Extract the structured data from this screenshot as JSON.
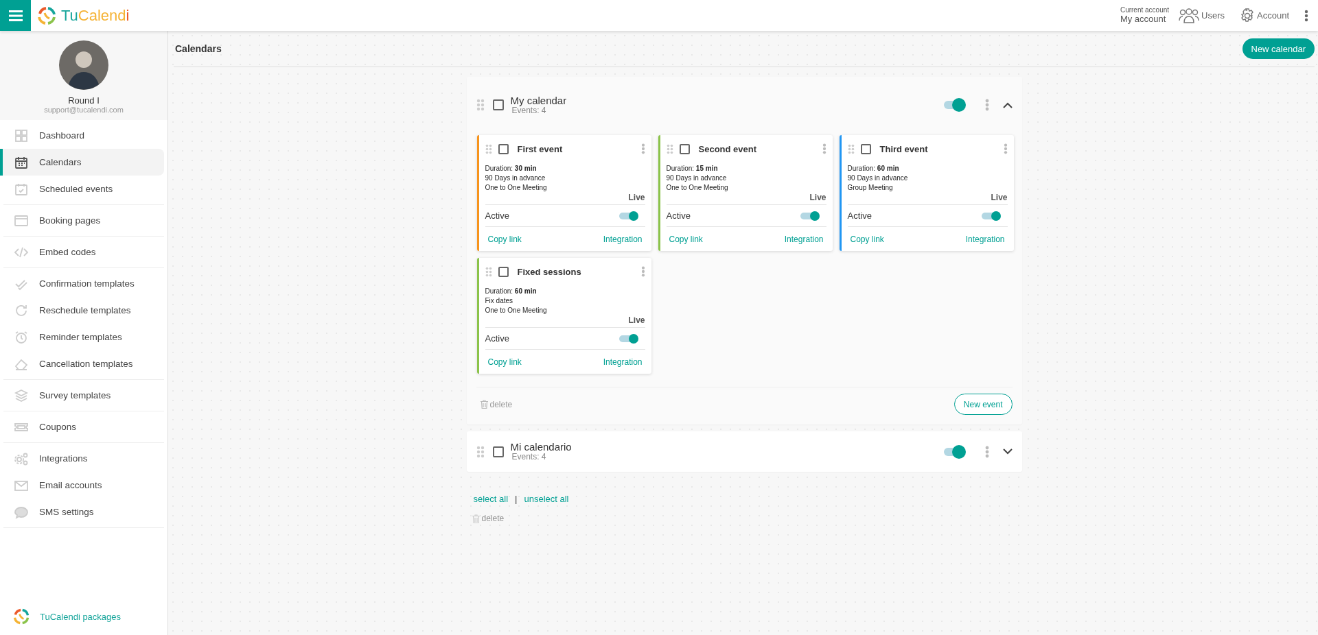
{
  "topbar": {
    "logo": [
      {
        "text": "Tu",
        "color": "#16a59b"
      },
      {
        "text": "Calend",
        "color": "#f5b335"
      },
      {
        "text": "i",
        "color": "#ec5a2a"
      }
    ],
    "current_account_label": "Current account",
    "current_account": "My account",
    "users": "Users",
    "account": "Account"
  },
  "sidebar": {
    "profile": {
      "name": "Round I",
      "email": "support@tucalendi.com"
    },
    "groups": [
      {
        "items": [
          {
            "label": "Dashboard",
            "selected": false
          },
          {
            "label": "Calendars",
            "selected": true
          },
          {
            "label": "Scheduled events",
            "selected": false
          }
        ]
      },
      {
        "items": [
          {
            "label": "Booking pages",
            "selected": false
          }
        ]
      },
      {
        "items": [
          {
            "label": "Embed codes",
            "selected": false
          }
        ]
      },
      {
        "items": [
          {
            "label": "Confirmation templates",
            "selected": false
          },
          {
            "label": "Reschedule templates",
            "selected": false
          },
          {
            "label": "Reminder templates",
            "selected": false
          },
          {
            "label": "Cancellation templates",
            "selected": false
          }
        ]
      },
      {
        "items": [
          {
            "label": "Survey templates",
            "selected": false
          }
        ]
      },
      {
        "items": [
          {
            "label": "Coupons",
            "selected": false
          }
        ]
      },
      {
        "items": [
          {
            "label": "Integrations",
            "selected": false
          },
          {
            "label": "Email accounts",
            "selected": false
          },
          {
            "label": "SMS settings",
            "selected": false
          }
        ]
      }
    ],
    "footer": "TuCalendi packages"
  },
  "page": {
    "title": "Calendars",
    "new_calendar": "New calendar"
  },
  "calendars": [
    {
      "name": "My calendar",
      "events_count": "Events: 4",
      "checked": false,
      "on": true,
      "expanded": true,
      "delete": "delete",
      "new_event": "New event",
      "events": [
        {
          "title": "First event",
          "checked": false,
          "color": "#f7941d",
          "details": [
            "Duration: **30 min**",
            "90 Days in advance",
            "One to One Meeting"
          ],
          "status": "Live",
          "active_label": "Active",
          "active": true,
          "copy_link": "Copy link",
          "integration": "Integration"
        },
        {
          "title": "Second event",
          "checked": false,
          "color": "#8bc34a",
          "details": [
            "Duration: **15 min**",
            "90 Days in advance",
            "One to One Meeting"
          ],
          "status": "Live",
          "active_label": "Active",
          "active": true,
          "copy_link": "Copy link",
          "integration": "Integration"
        },
        {
          "title": "Third event",
          "checked": false,
          "color": "#2196f3",
          "details": [
            "Duration: **60 min**",
            "90 Days in advance",
            "Group Meeting"
          ],
          "status": "Live",
          "active_label": "Active",
          "active": true,
          "copy_link": "Copy link",
          "integration": "Integration"
        },
        {
          "title": "Fixed sessions",
          "checked": false,
          "color": "#8bc34a",
          "details": [
            "Duration: **60 min**",
            "Fix dates",
            "One to One Meeting"
          ],
          "status": "Live",
          "active_label": "Active",
          "active": true,
          "copy_link": "Copy link",
          "integration": "Integration"
        }
      ]
    },
    {
      "name": "Mi calendario",
      "events_count": "Events: 4",
      "checked": false,
      "on": true,
      "expanded": false
    }
  ],
  "select_all": "select all",
  "separator": "|",
  "unselect_all": "unselect all",
  "delete": "delete"
}
